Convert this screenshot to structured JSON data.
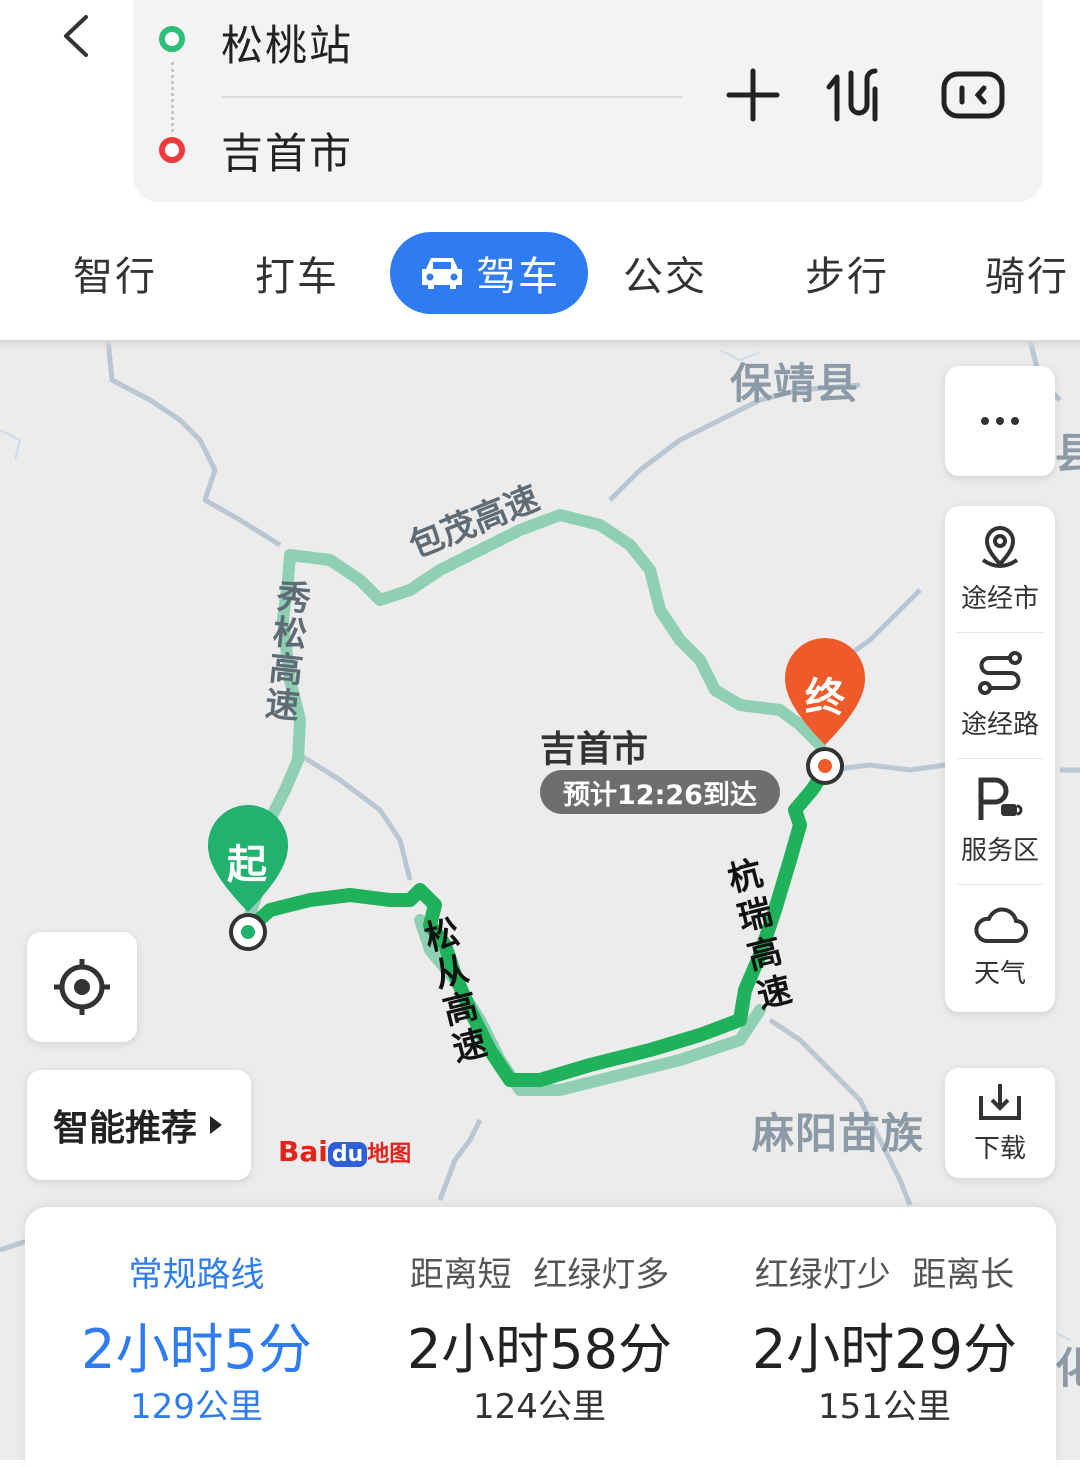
{
  "header": {
    "start": "松桃站",
    "end": "吉首市"
  },
  "tabs": [
    {
      "label": "智行"
    },
    {
      "label": "打车"
    },
    {
      "label": "驾车"
    },
    {
      "label": "公交"
    },
    {
      "label": "步行"
    },
    {
      "label": "骑行"
    }
  ],
  "map": {
    "places": {
      "baojing": "保靖县",
      "mayang": "麻阳苗族",
      "partial_county": "县",
      "partial_hua": "化"
    },
    "roads": {
      "baomao": "包茂高速",
      "xiusong": "秀松高速",
      "songcong": "松从高速",
      "hangrui": "杭瑞高速"
    },
    "city_center": "吉首市",
    "eta": "预计12:26到达",
    "markers": {
      "start": "起",
      "end": "终"
    },
    "logo": {
      "bai": "Bai",
      "du": "du",
      "map": "地图"
    }
  },
  "toolbar": {
    "via_city": "途经市",
    "via_road": "途经路",
    "service_area": "服务区",
    "weather": "天气",
    "download": "下载",
    "smart": "智能推荐"
  },
  "routes": [
    {
      "desc": "常规路线",
      "time": "2小时5分",
      "distance": "129公里",
      "selected": true
    },
    {
      "desc": "距离短  红绿灯多",
      "time": "2小时58分",
      "distance": "124公里",
      "selected": false
    },
    {
      "desc": "红绿灯少  距离长",
      "time": "2小时29分",
      "distance": "151公里",
      "selected": false
    }
  ],
  "colors": {
    "accent": "#2f7cf2",
    "route_main": "#1fb25a",
    "route_alt": "#8fd0b4",
    "start_marker": "#23b16e",
    "end_marker": "#ef5a2a"
  }
}
